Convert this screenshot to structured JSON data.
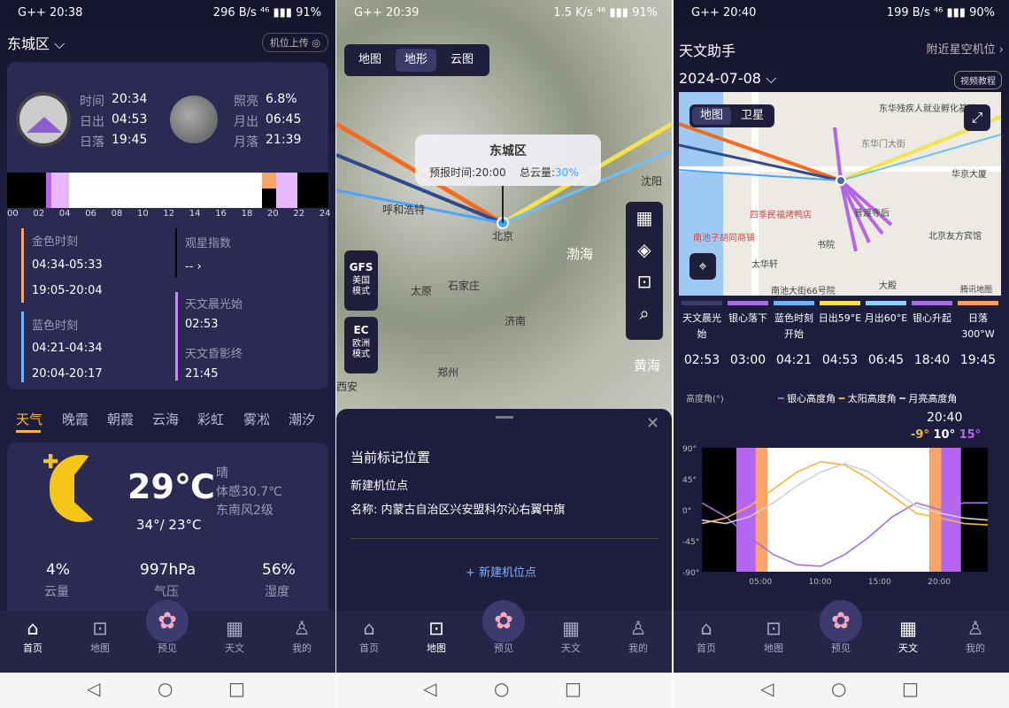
{
  "phones": [
    {
      "status_time": "G++ 20:38",
      "status_right": "296 B/s ⁴⁶ ▮▮▮ 91%"
    },
    {
      "status_time": "G++ 20:39",
      "status_right": "1.5 K/s ⁴⁶ ▮▮▮ 91%"
    },
    {
      "status_time": "G++ 20:40",
      "status_right": "199 B/s ⁴⁶ ▮▮▮ 90%"
    }
  ],
  "p1": {
    "location": "东城区",
    "upload": "机位上传",
    "time_label": "时间",
    "time": "20:34",
    "sunrise_label": "日出",
    "sunrise": "04:53",
    "sunset_label": "日落",
    "sunset": "19:45",
    "illum_label": "照亮",
    "illum": "6.8%",
    "moonrise_label": "月出",
    "moonrise": "06:45",
    "moonset_label": "月落",
    "moonset": "21:39",
    "ticks": [
      "00",
      "02",
      "04",
      "06",
      "08",
      "10",
      "12",
      "14",
      "16",
      "18",
      "20",
      "22",
      "24"
    ],
    "golden_label": "金色时刻",
    "golden1": "04:34-05:33",
    "golden2": "19:05-20:04",
    "star_label": "观星指数",
    "star_val": "-- ›",
    "blue_label": "蓝色时刻",
    "blue1": "04:21-04:34",
    "blue2": "20:04-20:17",
    "dawn_label": "天文晨光始",
    "dawn": "02:53",
    "dusk_label": "天文昏影终",
    "dusk": "21:45",
    "tabs": [
      "天气",
      "晚霞",
      "朝霞",
      "云海",
      "彩虹",
      "雾凇",
      "潮汐"
    ],
    "temp": "29℃",
    "cond": "晴",
    "feel": "体感30.7℃",
    "wind": "东南风2级",
    "range": "34°/ 23°C",
    "stats": [
      {
        "v": "4%",
        "l": "云量"
      },
      {
        "v": "997hPa",
        "l": "气压"
      },
      {
        "v": "56%",
        "l": "湿度"
      }
    ]
  },
  "p2": {
    "map_tabs": [
      "地图",
      "地形",
      "云图"
    ],
    "popup_title": "东城区",
    "popup_time": "预报时间:20:00",
    "popup_cloud_label": "总云量:",
    "popup_cloud": "30%",
    "places": [
      "沈阳",
      "呼和浩特",
      "北京",
      "渤海",
      "太原",
      "石家庄",
      "济南",
      "郑州",
      "黄海",
      "西安"
    ],
    "model1": "GFS",
    "model1_sub": "美国模式",
    "model2": "EC",
    "model2_sub": "欧洲模式",
    "sheet_title": "当前标记位置",
    "sheet_sub": "新建机位点",
    "sheet_name": "名称:  内蒙古自治区兴安盟科尔沁右翼中旗",
    "sheet_btn": "+ 新建机位点"
  },
  "p3": {
    "title": "天文助手",
    "nearby": "附近星空机位 ›",
    "date": "2024-07-08",
    "video": "视频教程",
    "map_tabs": [
      "地图",
      "卫星"
    ],
    "map_labels": [
      "东华残疾人就业孵化基地",
      "东华门大街",
      "华京大厦",
      "四季民福烤鸭店",
      "普渡寺后",
      "南池子胡同商铺",
      "书院",
      "北京友方宾馆",
      "太华轩",
      "大殿",
      "南池大街66号院",
      "腾讯地图"
    ],
    "cells": [
      {
        "l": "天文晨光始",
        "v": "02:53"
      },
      {
        "l": "银心落下",
        "v": "03:00"
      },
      {
        "l": "蓝色时刻开始",
        "v": "04:21"
      },
      {
        "l": "日出59°E",
        "v": "04:53"
      },
      {
        "l": "月出60°E",
        "v": "06:45"
      },
      {
        "l": "银心升起",
        "v": "18:40"
      },
      {
        "l": "日落300°W",
        "v": "19:45"
      }
    ],
    "colors": [
      "#3b3b6e",
      "#a56ee0",
      "#6bb5ff",
      "#f6e04a",
      "#8fd0ff",
      "#a56ee0",
      "#ff9d5c"
    ],
    "chart_ylabel": "高度角(°)",
    "legend": [
      "银心高度角",
      "太阳高度角",
      "月亮高度角"
    ],
    "now": "20:40",
    "now_vals": [
      "-9°",
      "10°",
      "15°"
    ]
  },
  "tabbar": [
    "首页",
    "地图",
    "预见",
    "天文",
    "我的"
  ],
  "chart_data": {
    "type": "line",
    "ylabel": "高度角(°)",
    "ylim": [
      -90,
      90
    ],
    "y_ticks": [
      "90°",
      "45°",
      "0°",
      "-45°",
      "-90°"
    ],
    "x_ticks": [
      "05:00",
      "10:00",
      "15:00",
      "20:00"
    ],
    "x": [
      0,
      2,
      4,
      6,
      8,
      10,
      12,
      14,
      16,
      18,
      20,
      22,
      24
    ],
    "series": [
      {
        "name": "银心高度角",
        "color": "#a56ee0",
        "values": [
          10,
          -10,
          -40,
          -65,
          -80,
          -82,
          -65,
          -40,
          -10,
          10,
          0,
          10,
          10
        ]
      },
      {
        "name": "太阳高度角",
        "color": "#f4b93a",
        "values": [
          -20,
          -12,
          5,
          30,
          55,
          70,
          65,
          45,
          20,
          -5,
          -12,
          -20,
          -22
        ]
      },
      {
        "name": "月亮高度角",
        "color": "#cfcfe2",
        "values": [
          -15,
          -20,
          -10,
          10,
          35,
          55,
          67,
          55,
          30,
          5,
          -5,
          -12,
          -15
        ]
      }
    ]
  }
}
